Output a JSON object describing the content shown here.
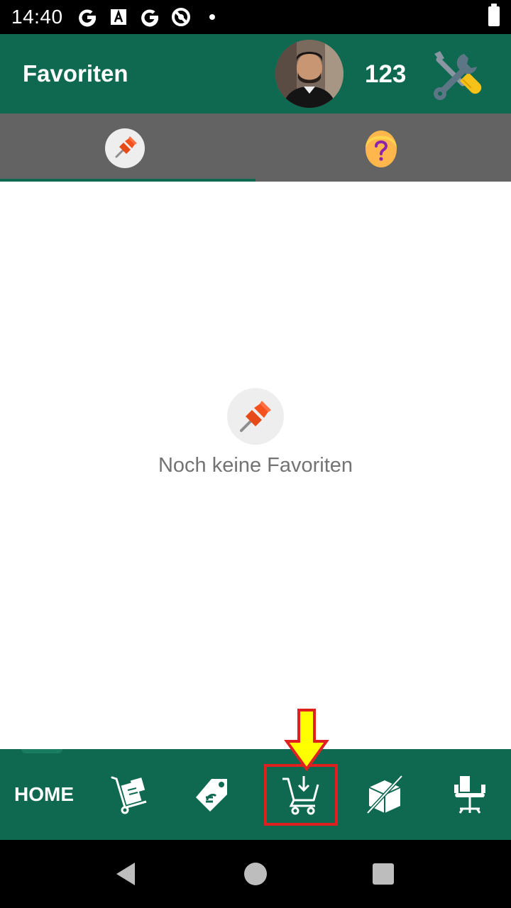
{
  "status_bar": {
    "time": "14:40",
    "icons": [
      "google-icon",
      "text-icon",
      "google-icon",
      "blocked-icon",
      "dot-icon"
    ],
    "battery": "battery-icon"
  },
  "app_bar": {
    "title": "Favoriten",
    "points": "123",
    "avatar": "avatar-photo",
    "tools": "tools-icon",
    "background_color": "#0f6950"
  },
  "tabs": [
    {
      "icon": "pushpin-icon",
      "selected": true
    },
    {
      "icon": "question-person-icon",
      "selected": false
    }
  ],
  "empty_state": {
    "icon": "pushpin-icon",
    "text": "Noch keine Favoriten"
  },
  "bottom_nav": {
    "home_label": "HOME",
    "items": [
      {
        "icon": "hand-truck-icon"
      },
      {
        "icon": "price-tag-icon"
      },
      {
        "icon": "cart-download-icon",
        "highlighted": true
      },
      {
        "icon": "box-crossed-icon"
      },
      {
        "icon": "office-chair-icon"
      }
    ]
  },
  "colors": {
    "primary": "#0f6950",
    "tab_bar": "#636363",
    "annotation_red": "#e02020",
    "annotation_arrow": "#ffff00"
  }
}
